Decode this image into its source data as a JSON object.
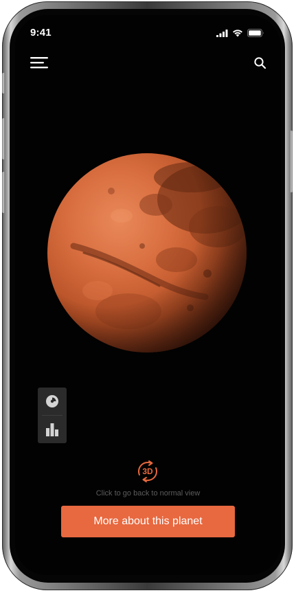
{
  "status_bar": {
    "time": "9:41",
    "icons": [
      "cellular-signal-icon",
      "wifi-icon",
      "battery-icon"
    ]
  },
  "header": {
    "menu_icon": "hamburger-menu-icon",
    "search_icon": "search-icon"
  },
  "planet": {
    "image": "mars-planet-image"
  },
  "side_panel": {
    "buttons": [
      {
        "icon": "pie-chart-icon"
      },
      {
        "icon": "bar-chart-icon"
      }
    ]
  },
  "view_toggle": {
    "label": "3D",
    "hint": "Click to go back to normal view"
  },
  "cta": {
    "label": "More about this planet"
  },
  "colors": {
    "accent": "#e8683f",
    "background": "#020202",
    "panel": "#2b2b2b",
    "hint_text": "#5d5d5d"
  }
}
